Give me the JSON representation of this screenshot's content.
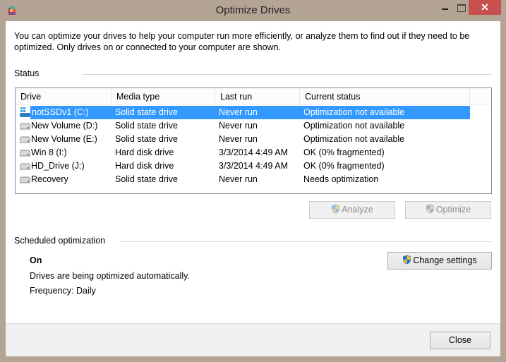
{
  "window": {
    "title": "Optimize Drives",
    "app_icon": "defrag-app-icon",
    "controls": {
      "minimize": "minimize",
      "maximize": "maximize",
      "close": "✕"
    }
  },
  "intro_text": "You can optimize your drives to help your computer run more efficiently, or analyze them to find out if they need to be optimized. Only drives on or connected to your computer are shown.",
  "status": {
    "label": "Status",
    "columns": [
      "Drive",
      "Media type",
      "Last run",
      "Current status"
    ],
    "rows": [
      {
        "drive": "notSSDv1 (C:)",
        "icon": "system-drive-icon",
        "media": "Solid state drive",
        "last_run": "Never run",
        "status": "Optimization not available",
        "selected": true
      },
      {
        "drive": "New Volume (D:)",
        "icon": "drive-icon",
        "media": "Solid state drive",
        "last_run": "Never run",
        "status": "Optimization not available",
        "selected": false
      },
      {
        "drive": "New Volume (E:)",
        "icon": "drive-icon",
        "media": "Solid state drive",
        "last_run": "Never run",
        "status": "Optimization not available",
        "selected": false
      },
      {
        "drive": "Win 8 (I:)",
        "icon": "drive-icon",
        "media": "Hard disk drive",
        "last_run": "3/3/2014 4:49 AM",
        "status": "OK (0% fragmented)",
        "selected": false
      },
      {
        "drive": "HD_Drive (J:)",
        "icon": "drive-icon",
        "media": "Hard disk drive",
        "last_run": "3/3/2014 4:49 AM",
        "status": "OK (0% fragmented)",
        "selected": false
      },
      {
        "drive": "Recovery",
        "icon": "drive-icon",
        "media": "Solid state drive",
        "last_run": "Never run",
        "status": "Needs optimization",
        "selected": false
      }
    ],
    "analyze_label": "Analyze",
    "optimize_label": "Optimize"
  },
  "scheduled": {
    "label": "Scheduled optimization",
    "state": "On",
    "description": "Drives are being optimized automatically.",
    "frequency": "Frequency: Daily",
    "change_settings_label": "Change settings"
  },
  "footer": {
    "close_label": "Close"
  },
  "colors": {
    "selection": "#3399ff",
    "close_button": "#c7504f",
    "frame": "#b4a496"
  }
}
